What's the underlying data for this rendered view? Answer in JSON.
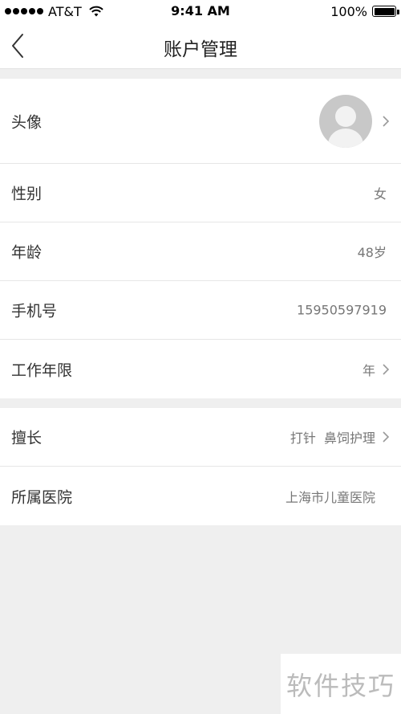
{
  "status_bar": {
    "carrier": "AT&T",
    "time": "9:41 AM",
    "battery": "100%"
  },
  "nav": {
    "title": "账户管理"
  },
  "sections": [
    {
      "rows": [
        {
          "label": "头像",
          "value": "",
          "has_avatar": true,
          "has_chevron": true
        },
        {
          "label": "性别",
          "value": "女",
          "has_chevron": false
        },
        {
          "label": "年龄",
          "value": "48岁",
          "has_chevron": false
        },
        {
          "label": "手机号",
          "value": "15950597919",
          "has_chevron": false
        },
        {
          "label": "工作年限",
          "value": "年",
          "has_chevron": true
        }
      ]
    },
    {
      "rows": [
        {
          "label": "擅长",
          "value": "打针  鼻饲护理",
          "has_chevron": true
        },
        {
          "label": "所属医院",
          "value": "上海市儿童医院",
          "has_chevron": false
        }
      ]
    }
  ],
  "watermark": "软件技巧",
  "icons": {
    "back": "chevron-left-icon",
    "row_arrow": "chevron-right-icon",
    "avatar": "default-avatar-icon"
  },
  "colors": {
    "background": "#efefef",
    "surface": "#ffffff",
    "divider": "#e6e6e6",
    "label": "#333333",
    "value": "#777777"
  }
}
